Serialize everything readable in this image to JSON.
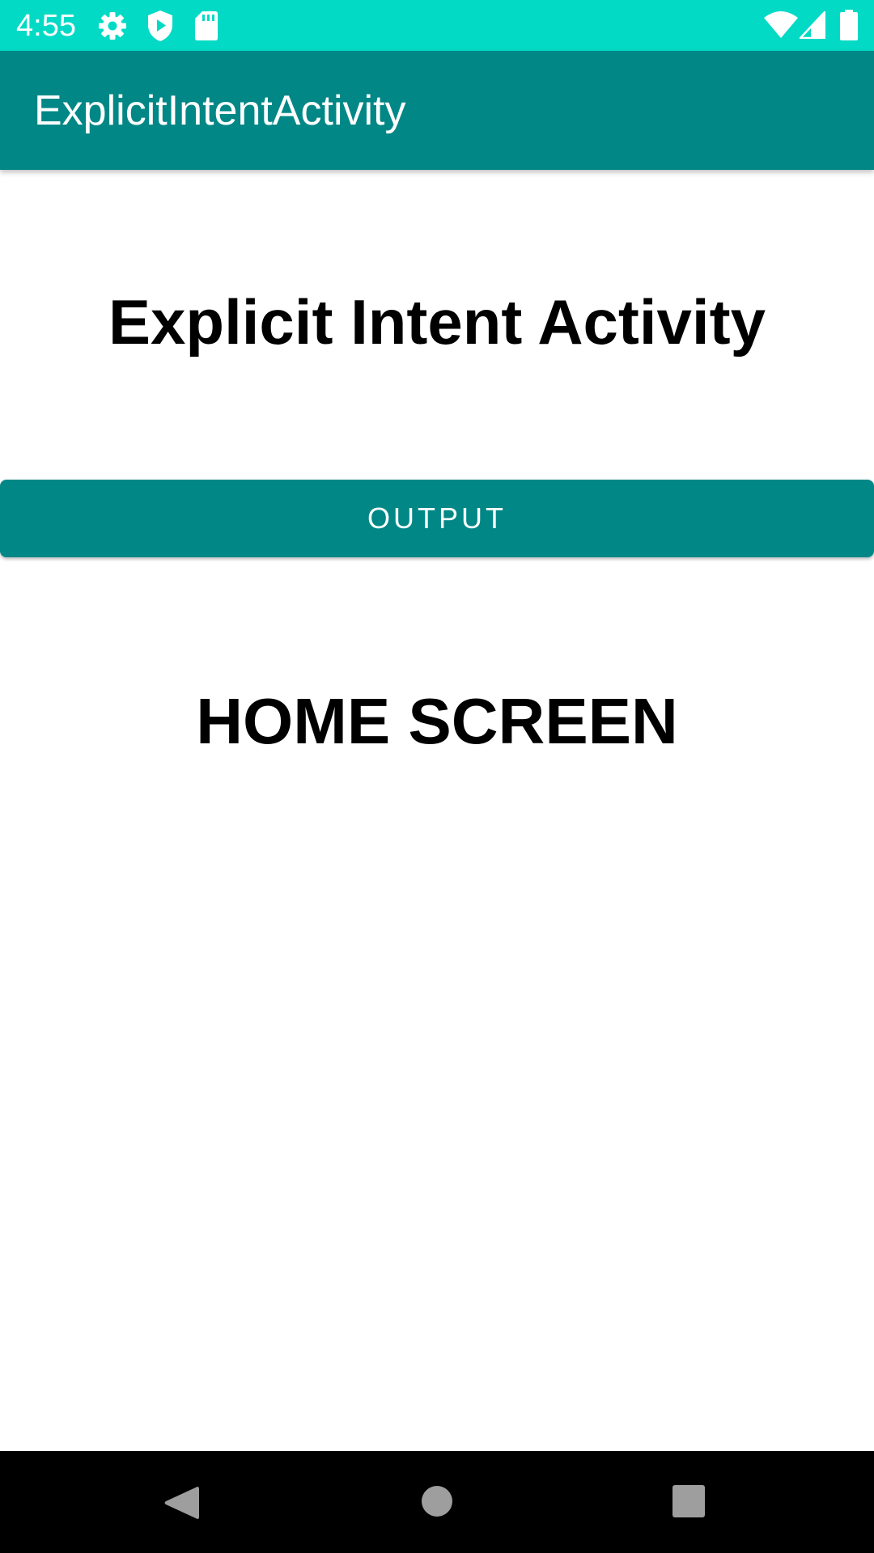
{
  "status_bar": {
    "time": "4:55",
    "background": "#03DAC5",
    "left_icons": [
      "settings-icon",
      "shield-play-icon",
      "sd-card-icon"
    ],
    "right_icons": [
      "wifi-icon",
      "cellular-signal-icon",
      "battery-icon"
    ]
  },
  "app_bar": {
    "title": "ExplicitIntentActivity",
    "background": "#018786"
  },
  "main": {
    "heading": "Explicit Intent Activity",
    "button_label": "OUTPUT",
    "button_color": "#018786",
    "screen_label": "HOME SCREEN"
  },
  "nav_bar": {
    "buttons": [
      "back-icon",
      "home-icon",
      "recents-icon"
    ]
  }
}
